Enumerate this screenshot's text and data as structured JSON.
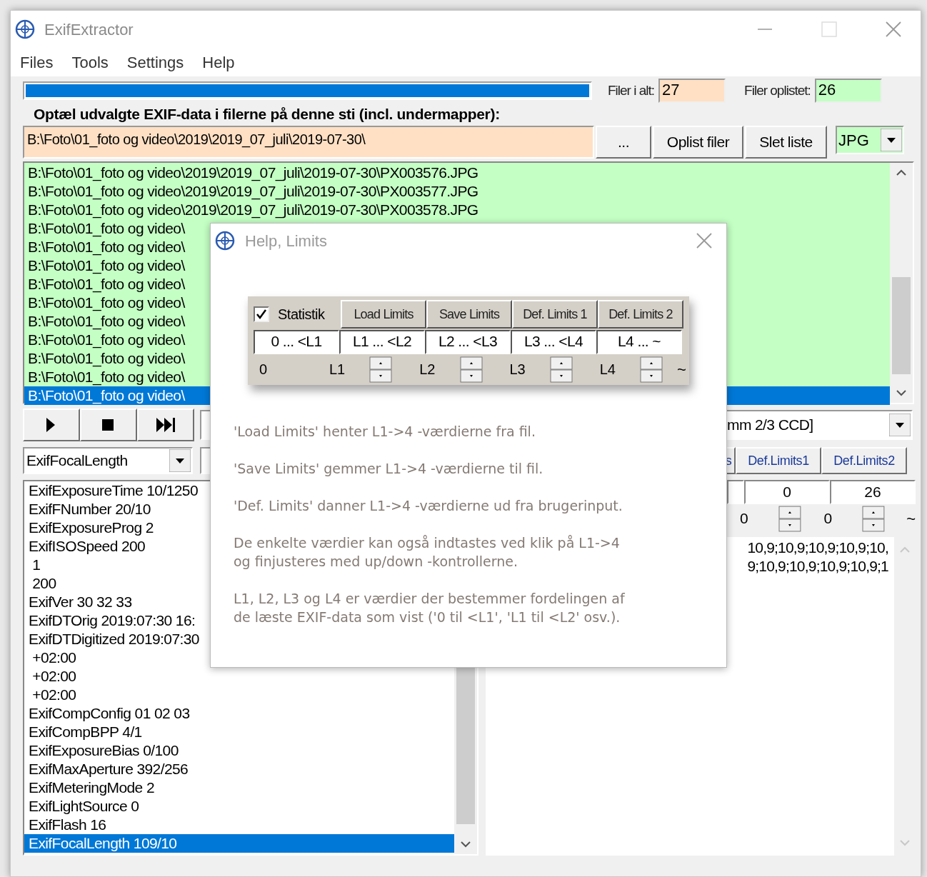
{
  "window": {
    "title": "ExifExtractor"
  },
  "menu": [
    "Files",
    "Tools",
    "Settings",
    "Help"
  ],
  "progress": {
    "level": 1
  },
  "counts": [
    {
      "label": "Filer i alt:",
      "value": "27",
      "color": "#ffe0c4"
    },
    {
      "label": "Filer oplistet:",
      "value": "26",
      "color": "#c4ffc4"
    }
  ],
  "path_label": "Optæl udvalgte EXIF-data i filerne på denne sti (incl. undermapper):",
  "path_field": {
    "value": "B:\\Foto\\01_foto og video\\2019\\2019_07_juli\\2019-07-30\\"
  },
  "path_buttons": [
    "...",
    "Oplist filer",
    "Slet liste"
  ],
  "type_combo": {
    "value": "JPG"
  },
  "file_list": [
    {
      "text": "B:\\Foto\\01_foto og video\\2019\\2019_07_juli\\2019-07-30\\PX003576.JPG",
      "selected": false
    },
    {
      "text": "B:\\Foto\\01_foto og video\\2019\\2019_07_juli\\2019-07-30\\PX003577.JPG",
      "selected": false
    },
    {
      "text": "B:\\Foto\\01_foto og video\\2019\\2019_07_juli\\2019-07-30\\PX003578.JPG",
      "selected": false
    },
    {
      "text": "B:\\Foto\\01_foto og video\\",
      "selected": false
    },
    {
      "text": "B:\\Foto\\01_foto og video\\",
      "selected": false
    },
    {
      "text": "B:\\Foto\\01_foto og video\\",
      "selected": false
    },
    {
      "text": "B:\\Foto\\01_foto og video\\",
      "selected": false
    },
    {
      "text": "B:\\Foto\\01_foto og video\\",
      "selected": false
    },
    {
      "text": "B:\\Foto\\01_foto og video\\",
      "selected": false
    },
    {
      "text": "B:\\Foto\\01_foto og video\\",
      "selected": false
    },
    {
      "text": "B:\\Foto\\01_foto og video\\",
      "selected": false
    },
    {
      "text": "B:\\Foto\\01_foto og video\\",
      "selected": false
    },
    {
      "text": "B:\\Foto\\01_foto og video\\",
      "selected": true
    }
  ],
  "playback_buttons": [
    {
      "kind": "play"
    },
    {
      "kind": "stop"
    },
    {
      "kind": "skip"
    }
  ],
  "tag_combo": {
    "value": "ExifFocalLength"
  },
  "camera_combo": {
    "value": "mm 2/3 CCD]"
  },
  "limit_buttons": [
    "s",
    "Def.Limits1",
    "Def.Limits2"
  ],
  "limit_fields": [
    "0",
    "26"
  ],
  "limit_spinners": [
    "0",
    "0"
  ],
  "limit_end": "~",
  "values_text": [
    "10,9;10,9;10,9;10,9;10,",
    "9;10,9;10,9;10,9;10,9;1"
  ],
  "exif_list": [
    {
      "text": "ExifExposureTime 10/1250",
      "selected": false
    },
    {
      "text": "ExifFNumber 20/10",
      "selected": false
    },
    {
      "text": "ExifExposureProg 2",
      "selected": false
    },
    {
      "text": "ExifISOSpeed 200",
      "selected": false
    },
    {
      "text": " 1",
      "selected": false
    },
    {
      "text": " 200",
      "selected": false
    },
    {
      "text": "ExifVer 30 32 33",
      "selected": false
    },
    {
      "text": "ExifDTOrig 2019:07:30 16:",
      "selected": false
    },
    {
      "text": "ExifDTDigitized 2019:07:30",
      "selected": false
    },
    {
      "text": " +02:00",
      "selected": false
    },
    {
      "text": " +02:00",
      "selected": false
    },
    {
      "text": " +02:00",
      "selected": false
    },
    {
      "text": "ExifCompConfig 01 02 03",
      "selected": false
    },
    {
      "text": "ExifCompBPP 4/1",
      "selected": false
    },
    {
      "text": "ExifExposureBias 0/100",
      "selected": false
    },
    {
      "text": "ExifMaxAperture 392/256",
      "selected": false
    },
    {
      "text": "ExifMeteringMode 2",
      "selected": false
    },
    {
      "text": "ExifLightSource 0",
      "selected": false
    },
    {
      "text": "ExifFlash 16",
      "selected": false
    },
    {
      "text": "ExifFocalLength 109/10",
      "selected": true
    }
  ],
  "dialog": {
    "title": "Help, Limits",
    "statistik": {
      "label": "Statistik",
      "checked": true
    },
    "buttons": [
      "Load Limits",
      "Save Limits",
      "Def. Limits 1",
      "Def. Limits 2"
    ],
    "ranges": [
      "0 ... <L1",
      "L1 ... <L2",
      "L2 ... <L3",
      "L3 ... <L4",
      "L4 ... ~"
    ],
    "scale_start": "0",
    "scale_marks": [
      "L1",
      "L2",
      "L3",
      "L4"
    ],
    "scale_end": "~",
    "paragraphs": [
      {
        "lines": [
          "'Load Limits' henter L1->4 -værdierne fra fil."
        ]
      },
      {
        "lines": [
          "'Save Limits' gemmer L1->4 -værdierne til fil."
        ]
      },
      {
        "lines": [
          "'Def. Limits' danner L1->4 -værdierne ud fra brugerinput."
        ]
      },
      {
        "lines": [
          "De enkelte værdier kan også indtastes ved klik på L1->4",
          "og finjusteres med up/down -kontrollerne."
        ]
      },
      {
        "lines": [
          "L1, L2, L3 og L4 er værdier der bestemmer fordelingen af",
          "de læste EXIF-data som vist ('0 til <L1', 'L1 til <L2' osv.)."
        ]
      }
    ]
  }
}
